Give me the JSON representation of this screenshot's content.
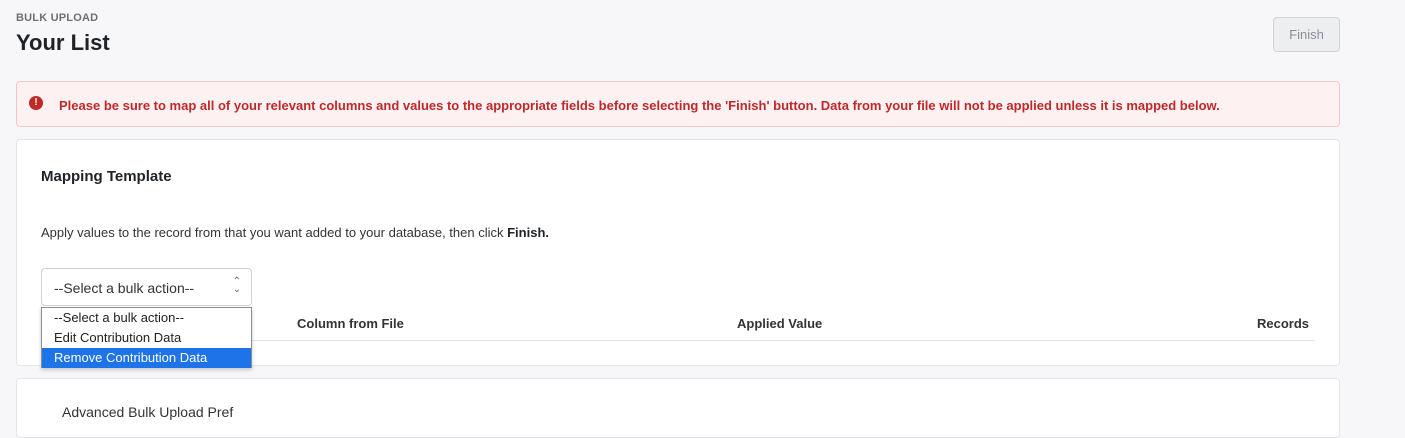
{
  "header": {
    "eyebrow": "BULK UPLOAD",
    "title": "Your List",
    "finish_label": "Finish"
  },
  "alert": {
    "icon": "exclamation-circle-icon",
    "icon_glyph": "!",
    "message": "Please be sure to map all of your relevant columns and values to the appropriate fields before selecting the 'Finish' button. Data from your file will not be applied unless it is mapped below."
  },
  "mapping": {
    "title": "Mapping Template",
    "description": "Apply values to the record from that you want added to your database, then click ",
    "description_emphasis": "Finish.",
    "select_value": "--Select a bulk action--",
    "chevron_up": "⌃",
    "chevron_down": "⌄",
    "options": [
      {
        "label": "--Select a bulk action--"
      },
      {
        "label": "Edit Contribution Data"
      },
      {
        "label": "Remove Contribution Data"
      }
    ],
    "highlighted_option": "Remove Contribution Data",
    "columns": {
      "column_from_file": "Column from File",
      "applied_value": "Applied Value",
      "records": "Records"
    }
  },
  "advanced": {
    "title_partial": "Advanced Bulk Upload Pref"
  },
  "colors": {
    "alert_text": "#c0292b",
    "alert_bg": "#fdf1f1",
    "highlight": "#1e73e8"
  }
}
